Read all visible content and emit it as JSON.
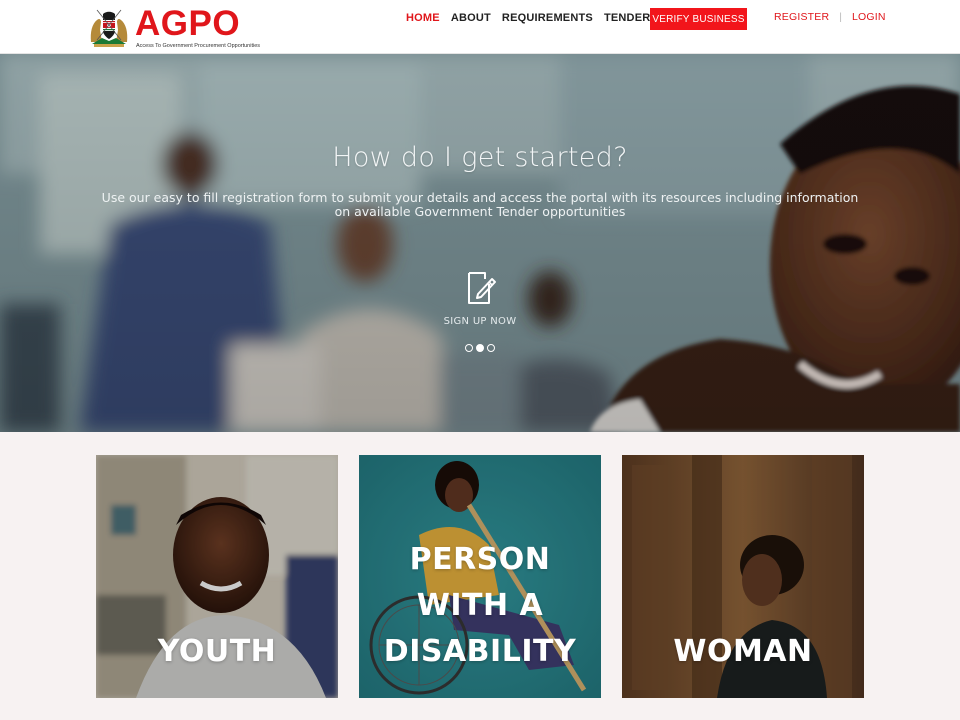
{
  "brand": {
    "name": "AGPO",
    "tagline": "Access To Government Procurement Opportunities",
    "color": "#e0161b"
  },
  "nav": {
    "items": [
      {
        "label": "HOME",
        "active": true
      },
      {
        "label": "ABOUT",
        "active": false
      },
      {
        "label": "REQUIREMENTS",
        "active": false
      },
      {
        "label": "TENDERS",
        "active": false
      }
    ],
    "verify_label": "VERIFY BUSINESS",
    "register_label": "REGISTER",
    "login_label": "LOGIN"
  },
  "hero": {
    "title": "How do I get started?",
    "subtitle": "Use our easy to fill registration form to submit your details and access the portal with its resources including information on available Government Tender opportunities",
    "cta_label": "SIGN UP NOW",
    "cta_icon": "edit-document-icon",
    "slides_total": 3,
    "active_slide": 2
  },
  "categories": [
    {
      "label": "YOUTH"
    },
    {
      "label": "PERSON WITH A DISABILITY"
    },
    {
      "label": "WOMAN"
    }
  ],
  "colors": {
    "accent": "#e0161b",
    "verify_button": "#f2151b",
    "page_background": "#f7f2f2"
  }
}
